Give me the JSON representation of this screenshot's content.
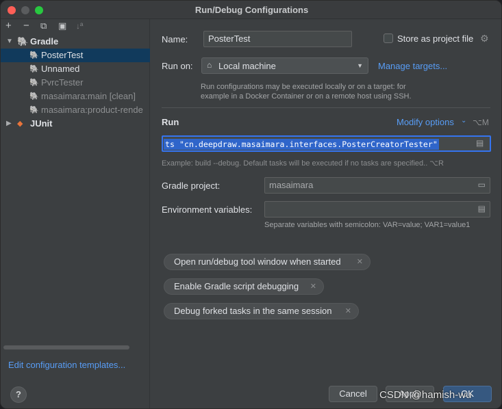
{
  "window": {
    "title": "Run/Debug Configurations"
  },
  "toolbar": {
    "add": "+",
    "remove": "−",
    "copy": "⧉",
    "folder": "▣",
    "sort": "↓ª"
  },
  "tree": {
    "gradle": {
      "label": "Gradle",
      "items": [
        {
          "label": "PosterTest",
          "selected": true
        },
        {
          "label": "Unnamed"
        },
        {
          "label": "PvrcTester"
        },
        {
          "label": "masaimara:main [clean]"
        },
        {
          "label": "masaimara:product-rende"
        }
      ]
    },
    "junit": {
      "label": "JUnit"
    }
  },
  "sidebar_footer": {
    "edit_templates": "Edit configuration templates...",
    "help": "?"
  },
  "form": {
    "name_label": "Name:",
    "name_value": "PosterTest",
    "store_label": "Store as project file",
    "run_on_label": "Run on:",
    "run_on_value": "Local machine",
    "manage_targets": "Manage targets...",
    "run_on_hint_1": "Run configurations may be executed locally or on a target: for",
    "run_on_hint_2": "example in a Docker Container or on a remote host using SSH.",
    "section_run": "Run",
    "modify_options": "Modify options",
    "modify_shortcut": "⌥M",
    "tasks_value": "ts \"cn.deepdraw.masaimara.interfaces.PosterCreatorTester\"",
    "tasks_hint": "Example: build --debug. Default tasks will be executed if no tasks are specified.. ⌥R",
    "gradle_project_label": "Gradle project:",
    "gradle_project_value": "masaimara",
    "env_label": "Environment variables:",
    "env_hint": "Separate variables with semicolon: VAR=value; VAR1=value1"
  },
  "chips": [
    "Open run/debug tool window when started",
    "Enable Gradle script debugging",
    "Debug forked tasks in the same session"
  ],
  "buttons": {
    "cancel": "Cancel",
    "apply": "Apply",
    "ok": "OK"
  },
  "watermark": "CSDN @hamish-wu"
}
